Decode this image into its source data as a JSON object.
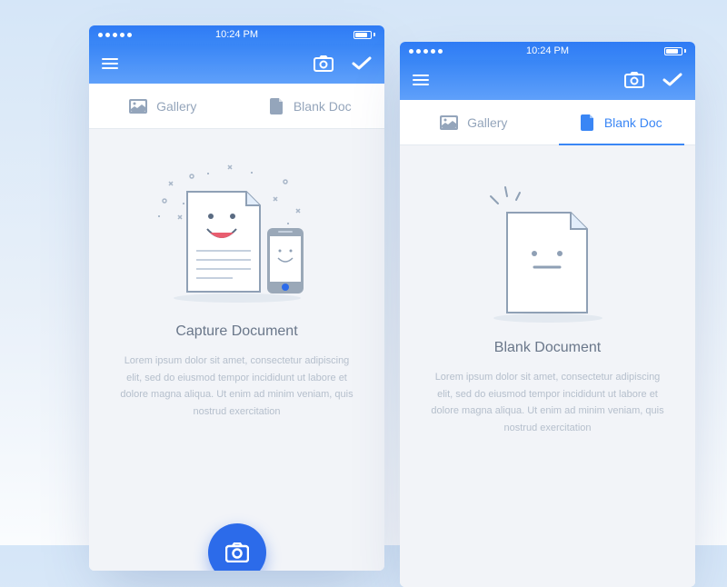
{
  "status": {
    "time": "10:24 PM"
  },
  "tabs": {
    "gallery": "Gallery",
    "blank": "Blank Doc"
  },
  "screens": {
    "capture": {
      "title": "Capture Document",
      "body": "Lorem ipsum dolor sit amet, consectetur adipiscing elit, sed do eiusmod tempor incididunt ut labore et dolore magna aliqua. Ut enim ad minim veniam, quis nostrud exercitation"
    },
    "blank": {
      "title": "Blank Document",
      "body": "Lorem ipsum dolor sit amet, consectetur adipiscing elit, sed do eiusmod tempor incididunt ut labore et dolore magna aliqua. Ut enim ad minim veniam, quis nostrud exercitation"
    }
  },
  "colors": {
    "accent": "#3a86f5",
    "fab": "#2c6bea",
    "text": "#6a778a",
    "muted": "#b5bfcc"
  }
}
